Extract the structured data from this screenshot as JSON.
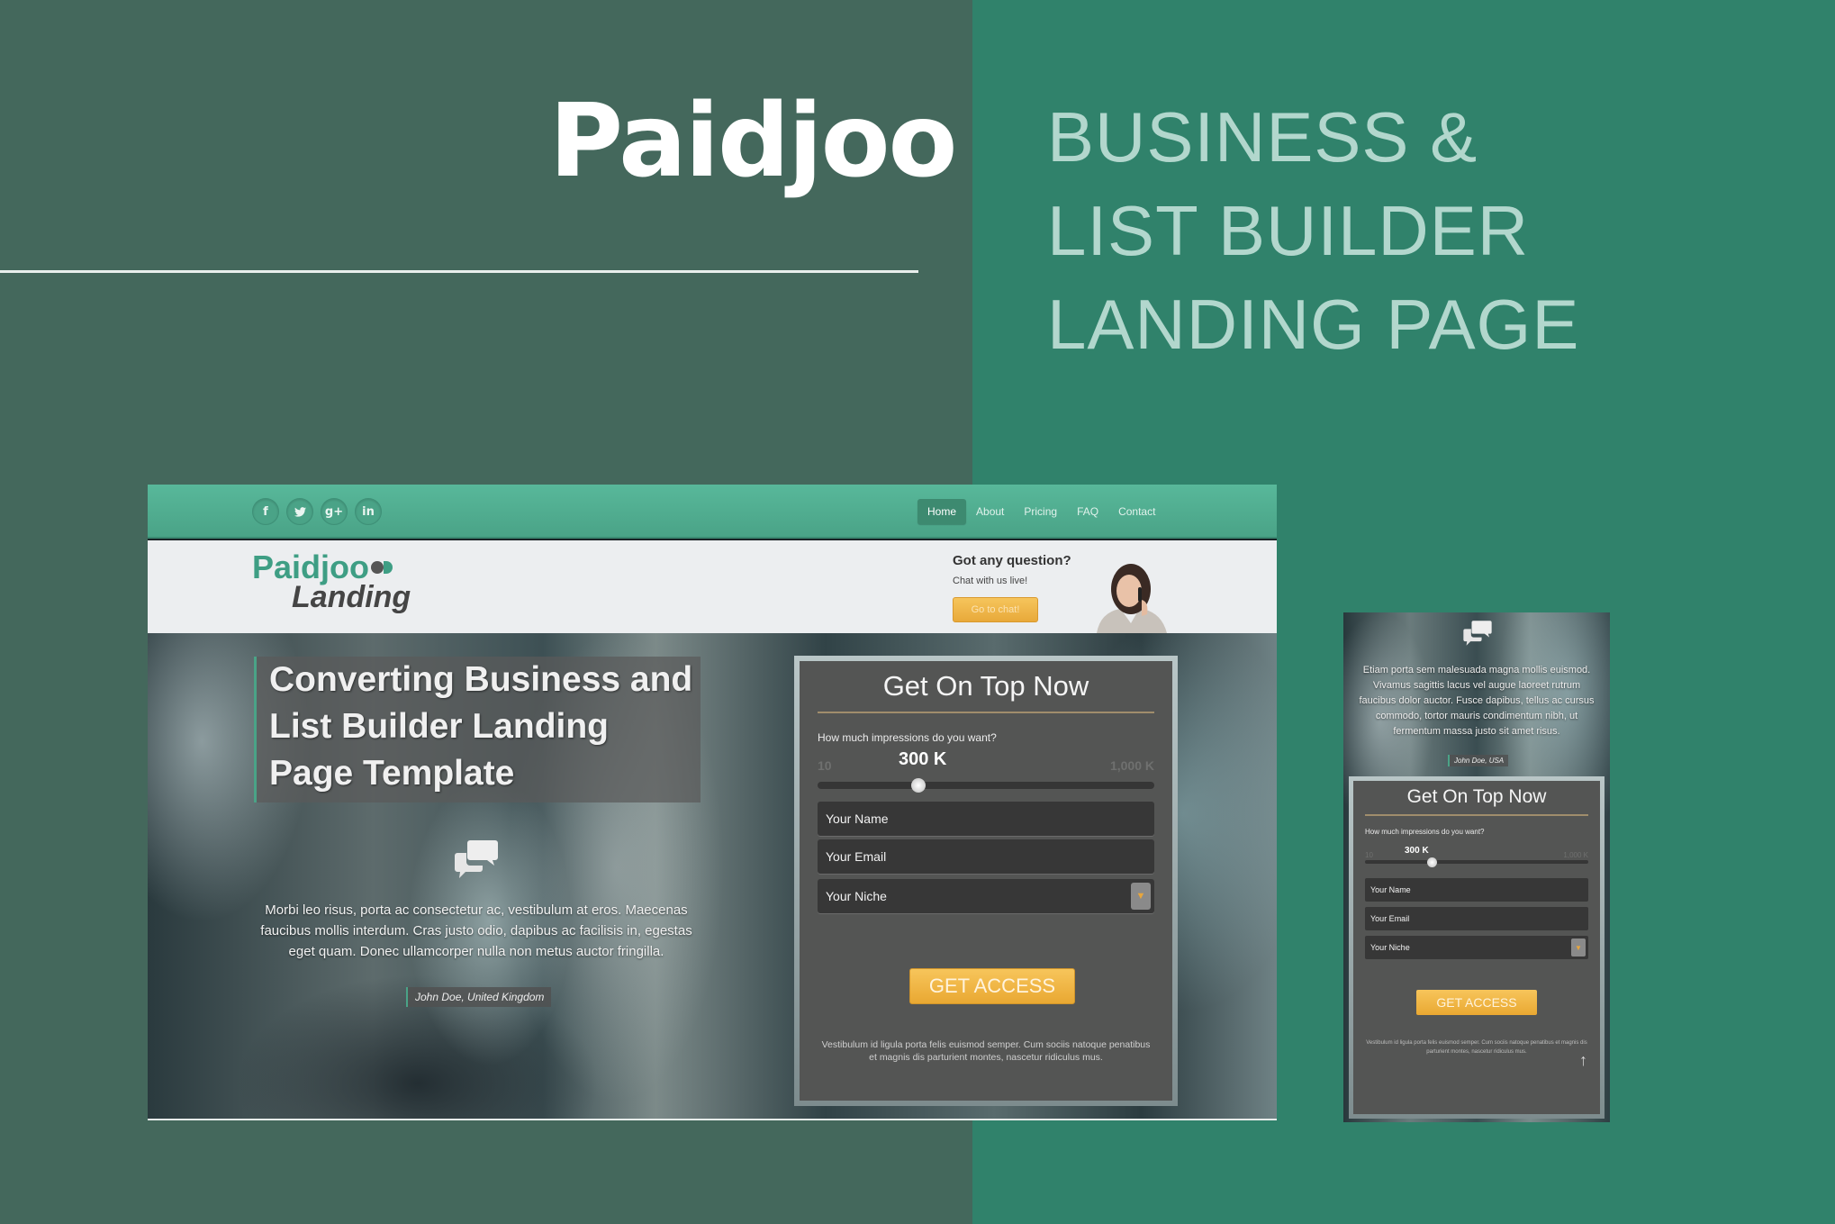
{
  "brand": {
    "title": "Paidjoo",
    "tagline": [
      "BUSINESS &",
      "LIST BUILDER",
      "LANDING PAGE"
    ]
  },
  "colors": {
    "left_panel": "#44685c",
    "right_panel": "#30826b",
    "accent_green": "#4aa387",
    "cta_orange": "#f0b444"
  },
  "desktop": {
    "social": [
      {
        "icon": "facebook-icon",
        "glyph": "f"
      },
      {
        "icon": "twitter-icon",
        "glyph": "🐦"
      },
      {
        "icon": "google-plus-icon",
        "glyph": "g+"
      },
      {
        "icon": "linkedin-icon",
        "glyph": "in"
      }
    ],
    "nav": [
      {
        "label": "Home",
        "active": true
      },
      {
        "label": "About",
        "active": false
      },
      {
        "label": "Pricing",
        "active": false
      },
      {
        "label": "FAQ",
        "active": false
      },
      {
        "label": "Contact",
        "active": false
      }
    ],
    "logo": {
      "top": "Paidjoo",
      "bottom": "Landing"
    },
    "question": {
      "title": "Got any question?",
      "subtitle": "Chat with us live!",
      "button": "Go to chat!"
    },
    "hero": {
      "title_lines": [
        "Converting Business and",
        "List Builder Landing",
        "Page Template"
      ],
      "quote": "Morbi leo risus, porta ac consectetur ac, vestibulum at eros. Maecenas faucibus mollis interdum. Cras justo odio, dapibus ac facilisis in, egestas eget quam. Donec ullamcorper nulla non metus auctor fringilla.",
      "author": "John Doe, United Kingdom"
    },
    "form": {
      "title": "Get On Top Now",
      "question": "How much impressions do you want?",
      "range_min": "10",
      "range_max": "1,000 K",
      "range_value": "300 K",
      "slider_fraction": 0.3,
      "name_placeholder": "Your Name",
      "email_placeholder": "Your Email",
      "niche_placeholder": "Your Niche",
      "submit": "GET ACCESS",
      "footnote": "Vestibulum id ligula porta felis euismod semper. Cum sociis natoque penatibus et magnis dis parturient montes, nascetur ridiculus mus."
    }
  },
  "mobile": {
    "quote": "Etiam porta sem malesuada magna mollis euismod. Vivamus sagittis lacus vel augue laoreet rutrum faucibus dolor auctor. Fusce dapibus, tellus ac cursus commodo, tortor mauris condimentum nibh, ut fermentum massa justo sit amet risus.",
    "author": "John Doe, USA",
    "form": {
      "title": "Get On Top Now",
      "question": "How much impressions do you want?",
      "range_min": "10",
      "range_max": "1,000 K",
      "range_value": "300 K",
      "slider_fraction": 0.3,
      "name_placeholder": "Your Name",
      "email_placeholder": "Your Email",
      "niche_placeholder": "Your Niche",
      "submit": "GET ACCESS",
      "footnote": "Vestibulum id ligula porta felis euismod semper. Cum sociis natoque penatibus et magnis dis parturient montes, nascetur ridiculus mus.",
      "scroll_top_glyph": "↑"
    }
  }
}
